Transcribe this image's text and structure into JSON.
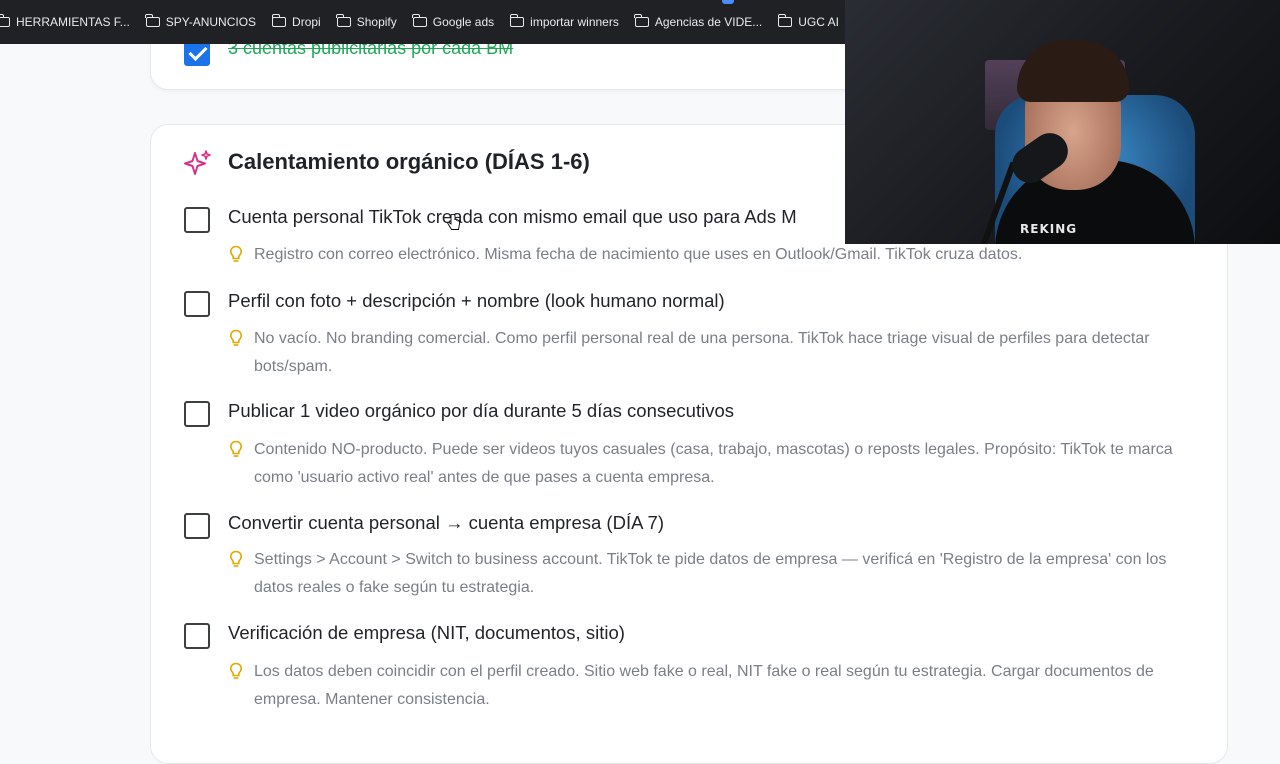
{
  "bookmarks": [
    {
      "label": "HERRAMIENTAS F...",
      "icon": "folder-icon"
    },
    {
      "label": "SPY-ANUNCIOS",
      "icon": "folder-icon"
    },
    {
      "label": "Dropi",
      "icon": "folder-icon"
    },
    {
      "label": "Shopify",
      "icon": "folder-icon"
    },
    {
      "label": "Google ads",
      "icon": "folder-icon"
    },
    {
      "label": "importar winners",
      "icon": "folder-icon"
    },
    {
      "label": "Agencias de VIDE...",
      "icon": "folder-icon"
    },
    {
      "label": "UGC AI",
      "icon": "folder-icon"
    },
    {
      "label": "",
      "icon": "document-icon"
    }
  ],
  "completed_item": {
    "label": "3 cuentas publicitarias por cada BM",
    "checked": true
  },
  "section": {
    "title": "Calentamiento orgánico (DÍAS 1-6)",
    "icon": "sparkle-icon",
    "icon_color": "#d6338b",
    "items": [
      {
        "title": "Cuenta personal TikTok creada con mismo email que uso para Ads M",
        "tip": "Registro con correo electrónico. Misma fecha de nacimiento que uses en Outlook/Gmail. TikTok cruza datos.",
        "checked": false
      },
      {
        "title": "Perfil con foto + descripción + nombre (look humano normal)",
        "tip": "No vacío. No branding comercial. Como perfil personal real de una persona. TikTok hace triage visual de perfiles para detectar bots/spam.",
        "checked": false
      },
      {
        "title": "Publicar 1 video orgánico por día durante 5 días consecutivos",
        "tip": "Contenido NO-producto. Puede ser videos tuyos casuales (casa, trabajo, mascotas) o reposts legales. Propósito: TikTok te marca como 'usuario activo real' antes de que pases a cuenta empresa.",
        "checked": false
      },
      {
        "title": "Convertir cuenta personal → cuenta empresa (DÍA 7)",
        "tip": "Settings > Account > Switch to business account. TikTok te pide datos de empresa — verificá en 'Registro de la empresa' con los datos reales o fake según tu estrategia.",
        "checked": false
      },
      {
        "title": "Verificación de empresa (NIT, documentos, sitio)",
        "tip": "Los datos deben coincidir con el perfil creado. Sitio web fake o real, NIT fake o real según tu estrategia. Cargar documentos de empresa. Mantener consistencia.",
        "checked": false
      }
    ]
  },
  "webcam": {
    "shirt_text": "REKING"
  },
  "colors": {
    "accent": "#1a73e8",
    "done_text": "#22a75a",
    "tip_icon": "#e0a800",
    "muted_text": "#7a7f87"
  }
}
